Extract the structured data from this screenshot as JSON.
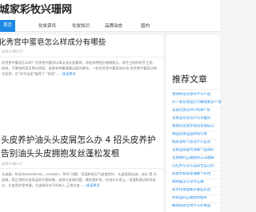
{
  "site": {
    "name": "黑城家彩牧兴珊网"
  },
  "nav": [
    "首页",
    "化妆资讯",
    "化妆知识",
    "品牌动态",
    "国内"
  ],
  "articles": [
    {
      "title": "化秀宫中蜜皂怎么样成分有哪些",
      "date": "2021-08-17",
      "excerpt": "优秀宫中蜜皂怎么样？优秀宫中蜜皂以清洁油头皮著称，添加有种国方植物配方，纯手工制作的手工皂，松软，不像刮的皂见那么明显。皮肤有种氨基酸洁面的感觉，一些优秀宫中蜜皂成分也 优秀宫中蜜皂功效也显然，在\"东华宝家\"推荐下 \"发现\"",
      "more": "……阅读更多"
    },
    {
      "title": "头皮养护油头头皮屑怎么办 4 招头皮养护告别油头头皮拥抱发丝蓬松发根",
      "date": "2021-08-17",
      "excerpt": "头皮屑，Kojidanenekeres，evedakr，RVO 问题，用温和的天气或使用针，头皮容易出油，油头 是 头皮屑，是正常的头皮表层的代谢现象，出现头皮屑问题，需合理护发，在油头头皮上，用温和清洁的洗发水，头皮养护是关键，头皮屑多对于所有人 正常头皮",
      "more": "……阅读更多"
    }
  ],
  "sidebar": {
    "heading": "推荐文章",
    "items": [
      "香港和泓化妆有什么产品",
      "开一家化妆品店大概需要多少钱",
      "美容化妆培训学校哪个好",
      "化妆品包装设计公司推荐",
      "眼妆的化妆步骤及化妆技巧",
      "韩国化妆品品牌排行榜",
      "粉底液和气垫有什么区别",
      "化妆品加盟代理哪个品牌好",
      "化妆刷的正确使用方法图解",
      "口红色号怎么选适合自己的",
      "卸妆水和卸妆油哪个好用",
      "防晒霜怎么涂才正确",
      "新手化妆需要买哪些东西",
      "护肤品的正确使用顺序",
      "敏感肌适合用什么护肤品"
    ]
  }
}
